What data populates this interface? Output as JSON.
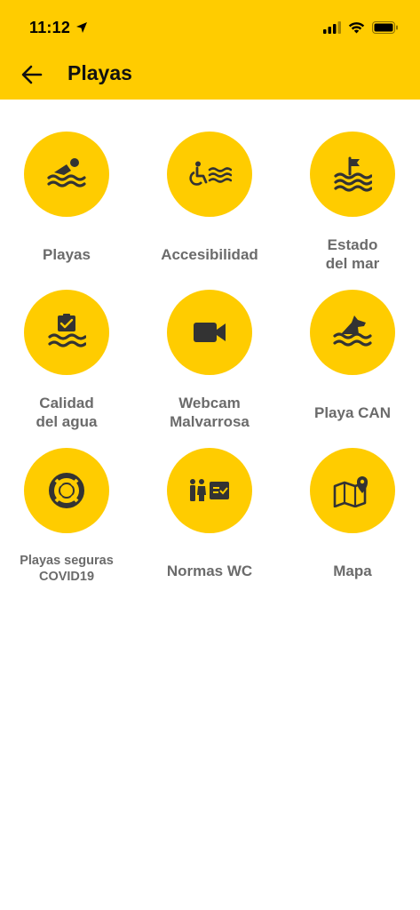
{
  "status_bar": {
    "time": "11:12"
  },
  "header": {
    "title": "Playas",
    "back_icon": "arrow-left-icon"
  },
  "colors": {
    "accent": "#FFCC00",
    "icon": "#333333",
    "label": "#6b6b6b"
  },
  "tiles": [
    {
      "label": "Playas",
      "icon": "swimmer-icon"
    },
    {
      "label": "Accesibilidad",
      "icon": "wheelchair-waves-icon"
    },
    {
      "label": "Estado\ndel mar",
      "icon": "flag-waves-icon"
    },
    {
      "label": "Calidad\ndel agua",
      "icon": "clipboard-check-waves-icon"
    },
    {
      "label": "Webcam\nMalvarrosa",
      "icon": "video-camera-icon"
    },
    {
      "label": "Playa CAN",
      "icon": "dog-waves-icon"
    },
    {
      "label": "Playas seguras\nCOVID19",
      "icon": "lifebuoy-icon"
    },
    {
      "label": "Normas WC",
      "icon": "restroom-sign-icon"
    },
    {
      "label": "Mapa",
      "icon": "map-pin-icon"
    }
  ]
}
